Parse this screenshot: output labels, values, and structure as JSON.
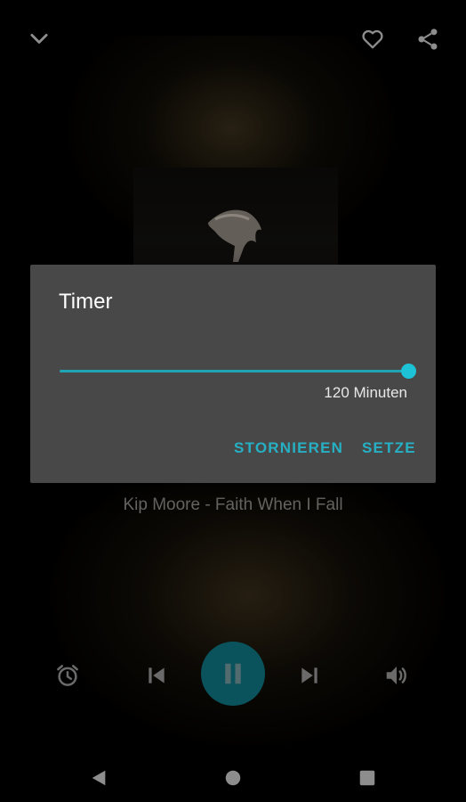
{
  "header": {
    "collapse_icon": "chevron-down-icon",
    "favorite_icon": "heart-icon",
    "share_icon": "share-icon"
  },
  "now_playing": {
    "artist_title": "Kip Moore - Faith When I Fall"
  },
  "controls": {
    "timer_icon": "alarm-icon",
    "previous_icon": "skip-previous-icon",
    "play_pause_icon": "pause-icon",
    "next_icon": "skip-next-icon",
    "volume_icon": "volume-icon"
  },
  "dialog": {
    "title": "Timer",
    "slider_fraction": 1.0,
    "slider_value_label": "120 Minuten",
    "cancel_label": "STORNIEREN",
    "confirm_label": "SETZE"
  },
  "navbar": {
    "back_icon": "back-triangle-icon",
    "home_icon": "home-circle-icon",
    "recents_icon": "recents-square-icon"
  },
  "colors": {
    "accent": "#1ec2d6",
    "play_button": "#0e6f7b",
    "dialog_bg": "#484848"
  }
}
